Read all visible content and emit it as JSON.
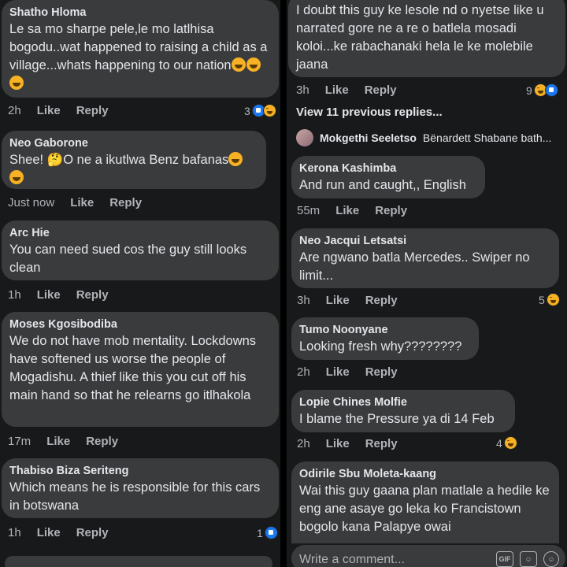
{
  "left": {
    "comments": [
      {
        "author": "Shatho Hloma",
        "text": "Le sa mo sharpe pele,le mo latlhisa bogodu..wat happened to raising a child as a village...whats happening to our nation",
        "emojis": 3,
        "time": "2h",
        "like": "Like",
        "reply": "Reply",
        "reaction_count": "3",
        "reactions": [
          "like",
          "haha"
        ]
      },
      {
        "author": "Neo Gaborone",
        "text": "Shee! 🤔O ne a ikutlwa Benz bafanas",
        "emojis": 2,
        "time": "Just now",
        "like": "Like",
        "reply": "Reply"
      },
      {
        "author": "Arc Hie",
        "text": "You can need sued cos the guy still looks clean",
        "time": "1h",
        "like": "Like",
        "reply": "Reply"
      },
      {
        "author": "Moses Kgosibodiba",
        "text": "We do not have mob mentality. Lockdowns have softened us worse the people of Mogadishu. A thief like this you cut off his main hand so that he relearns go itlhakola",
        "time": "17m",
        "like": "Like",
        "reply": "Reply"
      },
      {
        "author": "Thabiso Biza Seriteng",
        "text": "Which means  he  is responsible  for this cars in botswana",
        "time": "1h",
        "like": "Like",
        "reply": "Reply",
        "reaction_count": "1",
        "reactions": [
          "like"
        ]
      }
    ]
  },
  "right": {
    "top_comment": {
      "text": "I doubt this guy ke lesole nd o nyetse like u narrated gore ne a re o batlela mosadi koloi...ke rabachanaki hela  le ke molebile jaana",
      "time": "3h",
      "like": "Like",
      "reply": "Reply",
      "reaction_count": "9",
      "reactions": [
        "haha",
        "like"
      ]
    },
    "view_previous": "View 11 previous replies...",
    "thread": {
      "author": "Mokgethi Seeletso",
      "rest": "Bënardett Shabane bath..."
    },
    "comments": [
      {
        "author": "Kerona Kashimba",
        "text": "And run and caught,, English",
        "time": "55m",
        "like": "Like",
        "reply": "Reply"
      },
      {
        "author": "Neo Jacqui Letsatsi",
        "text": "Are ngwano batla Mercedes.. Swiper no limit...",
        "time": "3h",
        "like": "Like",
        "reply": "Reply",
        "reaction_count": "5",
        "reactions": [
          "haha"
        ]
      },
      {
        "author": "Tumo Noonyane",
        "text": "Looking fresh why????????",
        "time": "2h",
        "like": "Like",
        "reply": "Reply"
      },
      {
        "author": "Lopie Chines Molfie",
        "text": "I blame the Pressure ya di 14 Feb",
        "time": "2h",
        "like": "Like",
        "reply": "Reply",
        "reaction_count": "4",
        "reactions": [
          "haha"
        ]
      },
      {
        "author": "Odirile Sbu Moleta-kaang",
        "text": "Wai this guy gaana plan matlale a hedile ke eng ane asaye go leka ko Francistown bogolo kana Palapye owai",
        "time": "",
        "like": "",
        "reply": ""
      }
    ],
    "composer": {
      "placeholder": "Write a comment...",
      "gif": "GIF"
    }
  },
  "colors": {
    "bg": "#18191a",
    "bubble": "#3a3b3c",
    "text": "#e4e6eb",
    "secondary": "#b0b3b8",
    "like": "#1877f2",
    "haha": "#f7b125"
  }
}
